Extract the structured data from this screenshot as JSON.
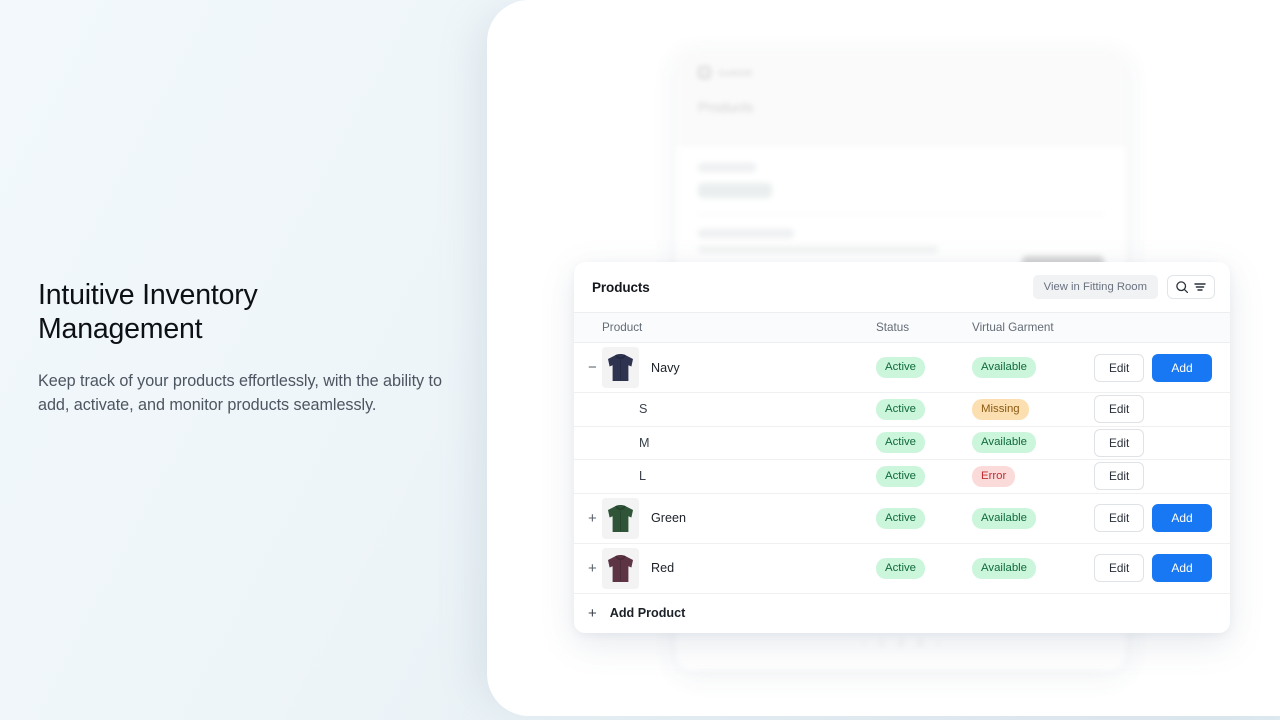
{
  "hero": {
    "headline_line1": "Intuitive Inventory",
    "headline_line2": "Management",
    "subcopy": "Keep track of your products effortlessly, with the ability to add, activate, and monitor products seamlessly."
  },
  "background_card": {
    "logo_text": "OutfitXR",
    "title": "Products",
    "pager": [
      "‹",
      "1",
      "2",
      "3",
      "›"
    ]
  },
  "card": {
    "title": "Products",
    "fitting_room_button": "View in Fitting Room",
    "search_icon": "search-icon",
    "filter_icon": "filter-icon",
    "columns": {
      "product": "Product",
      "status": "Status",
      "garment": "Virtual Garment"
    },
    "rows": [
      {
        "expander": "−",
        "name": "Navy",
        "type": "parent",
        "thumb_color": "#2e3350",
        "thumb_shade": "#242943",
        "status": "Active",
        "status_tone": "green",
        "garment": "Available",
        "garment_tone": "green",
        "edit_label": "Edit",
        "add_label": "Add"
      },
      {
        "expander": "",
        "name": "S",
        "type": "variant",
        "status": "Active",
        "status_tone": "green",
        "garment": "Missing",
        "garment_tone": "orange",
        "edit_label": "Edit",
        "add_label": ""
      },
      {
        "expander": "",
        "name": "M",
        "type": "variant",
        "status": "Active",
        "status_tone": "green",
        "garment": "Available",
        "garment_tone": "green",
        "edit_label": "Edit",
        "add_label": ""
      },
      {
        "expander": "",
        "name": "L",
        "type": "variant",
        "status": "Active",
        "status_tone": "green",
        "garment": "Error",
        "garment_tone": "red",
        "edit_label": "Edit",
        "add_label": ""
      },
      {
        "expander": "+",
        "name": "Green",
        "type": "parent",
        "thumb_color": "#2f5437",
        "thumb_shade": "#25442c",
        "status": "Active",
        "status_tone": "green",
        "garment": "Available",
        "garment_tone": "green",
        "edit_label": "Edit",
        "add_label": "Add"
      },
      {
        "expander": "+",
        "name": "Red",
        "type": "parent",
        "thumb_color": "#5d3444",
        "thumb_shade": "#4b2a37",
        "status": "Active",
        "status_tone": "green",
        "garment": "Available",
        "garment_tone": "green",
        "edit_label": "Edit",
        "add_label": "Add"
      }
    ],
    "footer": {
      "plus": "+",
      "label": "Add Product"
    }
  },
  "colors": {
    "accent_blue": "#1877f2",
    "badge_green_bg": "#ccf6dc",
    "badge_green_text": "#106a3b",
    "badge_orange_bg": "#fbdfb0",
    "badge_orange_text": "#8a5a12",
    "badge_red_bg": "#fbdada",
    "badge_red_text": "#bf2f33"
  }
}
